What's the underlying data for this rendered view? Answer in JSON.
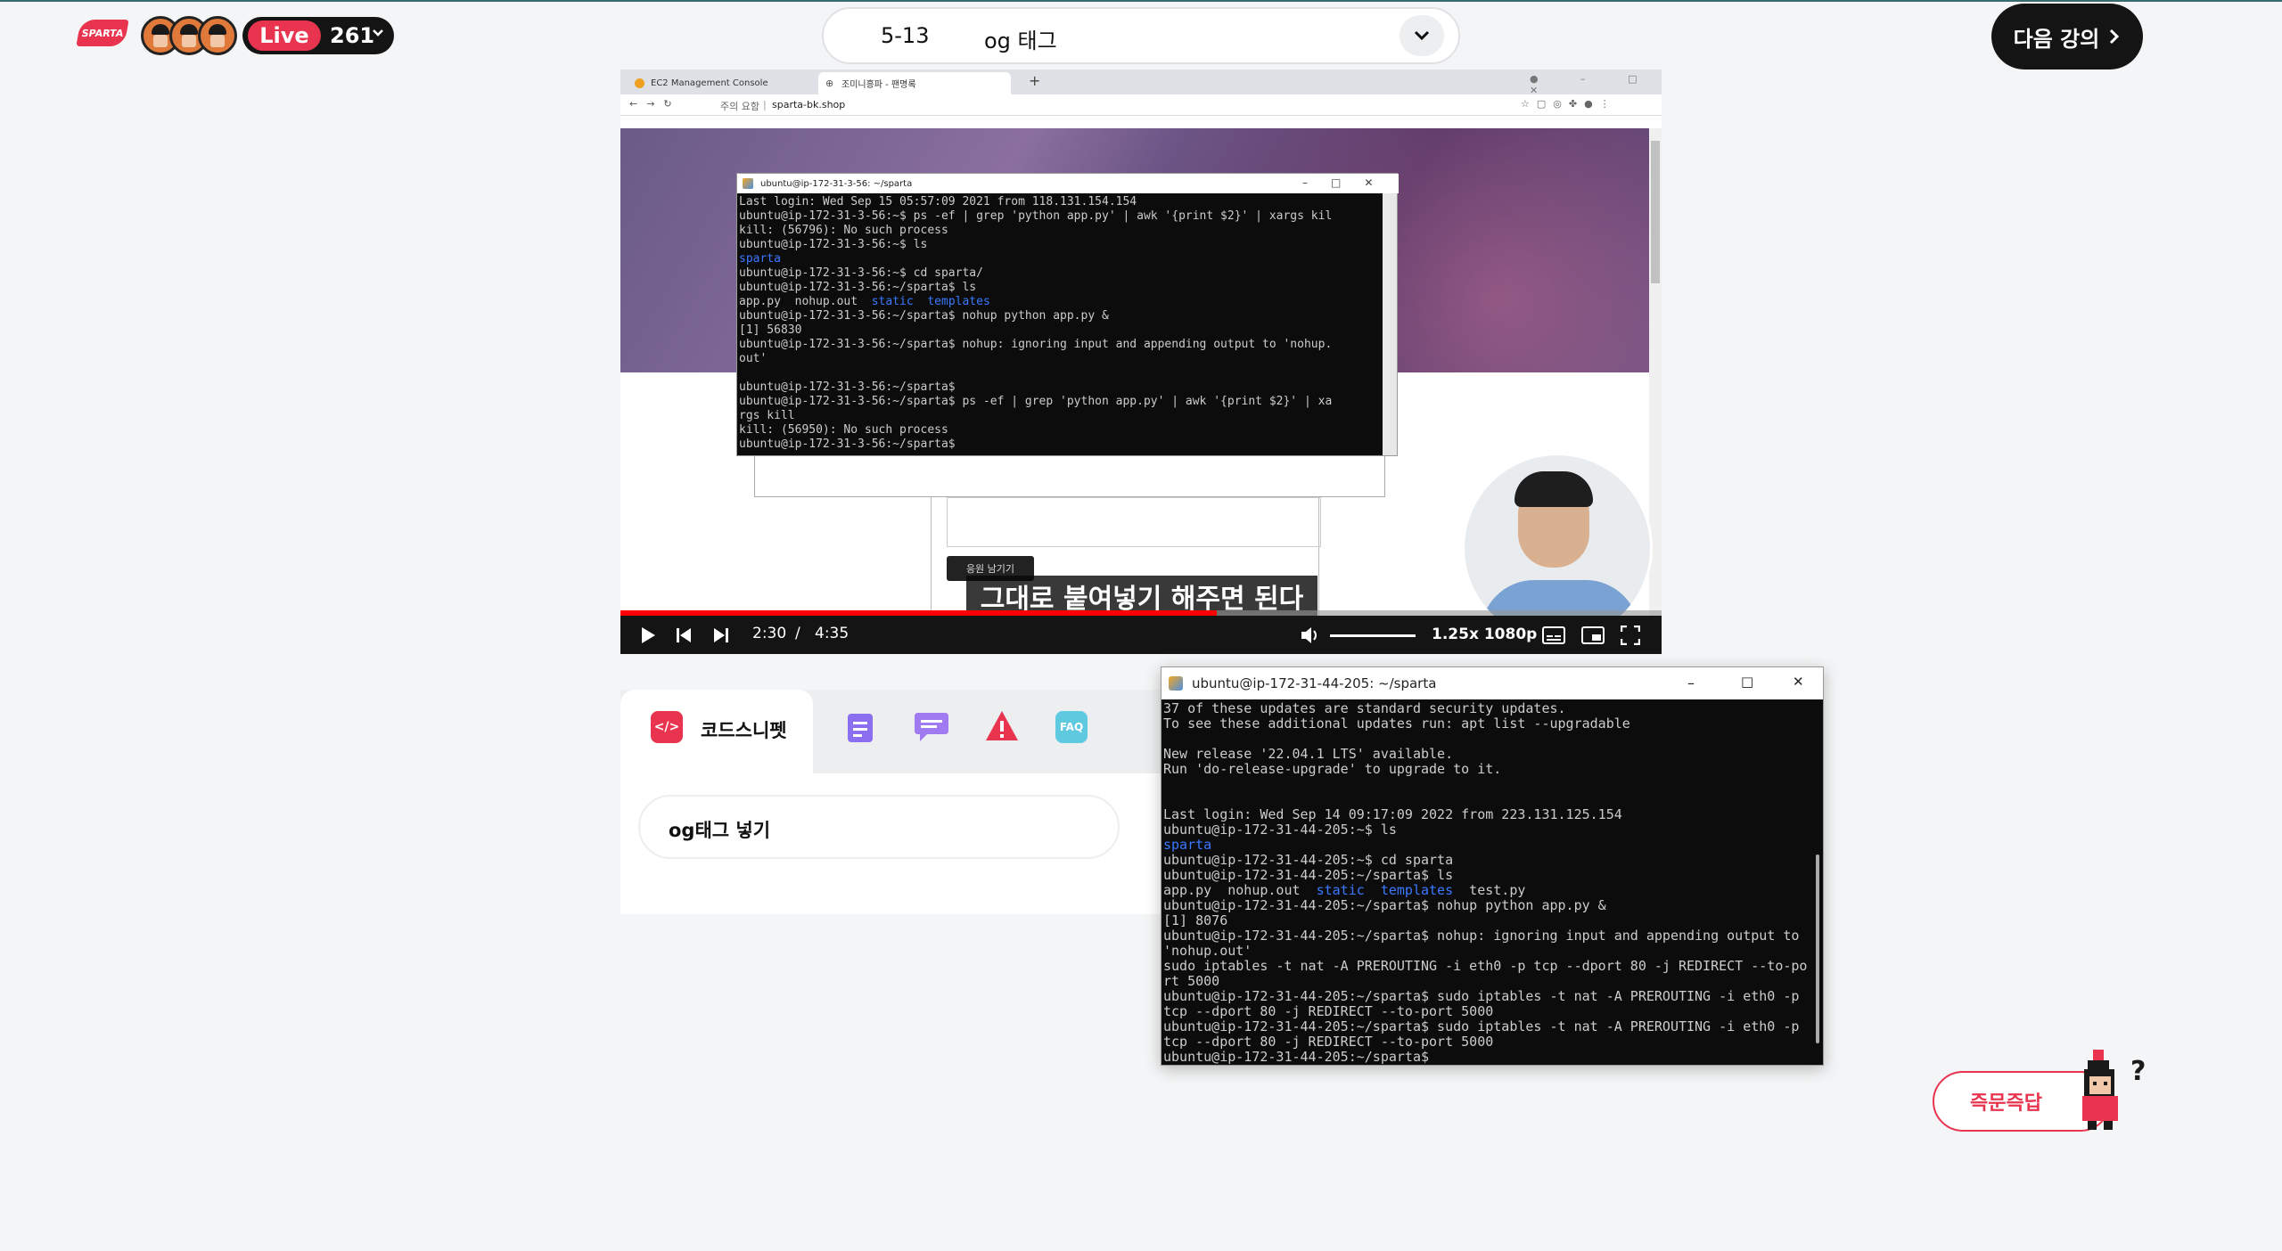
{
  "header": {
    "logo_text": "SPARTA",
    "live_label": "Live",
    "live_count": "261",
    "lecture_number": "5-13",
    "lecture_title": "og 태그",
    "next_button": "다음 강의"
  },
  "video": {
    "browser_tabs": [
      "EC2 Management Console",
      "조미니흥파 - 팬명록"
    ],
    "address_warning": "주의 요함",
    "address_url": "sparta-bk.shop",
    "form_button": "응원 남기기",
    "small_terminal": {
      "title": "ubuntu@ip-172-31-3-56: ~/sparta",
      "lines": [
        "Last login: Wed Sep 15 05:57:09 2021 from 118.131.154.154",
        "ubuntu@ip-172-31-3-56:~$ ps -ef | grep 'python app.py' | awk '{print $2}' | xargs kil",
        "kill: (56796): No such process",
        "ubuntu@ip-172-31-3-56:~$ ls",
        "sparta",
        "ubuntu@ip-172-31-3-56:~$ cd sparta/",
        "ubuntu@ip-172-31-3-56:~/sparta$ ls",
        "app.py  nohup.out  static  templates",
        "ubuntu@ip-172-31-3-56:~/sparta$ nohup python app.py &",
        "[1] 56830",
        "ubuntu@ip-172-31-3-56:~/sparta$ nohup: ignoring input and appending output to 'nohup.",
        "out'",
        "",
        "ubuntu@ip-172-31-3-56:~/sparta$",
        "ubuntu@ip-172-31-3-56:~/sparta$ ps -ef | grep 'python app.py' | awk '{print $2}' | xa",
        "rgs kill",
        "kill: (56950): No such process",
        "ubuntu@ip-172-31-3-56:~/sparta$"
      ]
    },
    "caption": "그대로 붙여넣기 해주면 된다",
    "progress": 0.5725,
    "time_current": "2:30",
    "time_separator": "/",
    "time_total": "4:35",
    "speed_quality": "1.25x 1080p"
  },
  "lower_panel": {
    "tab_code_label": "코드스니펫",
    "tab_faq_label": "FAQ",
    "snippet_text": "og태그 넣기"
  },
  "big_terminal": {
    "title": "ubuntu@ip-172-31-44-205: ~/sparta",
    "lines": [
      "37 of these updates are standard security updates.",
      "To see these additional updates run: apt list --upgradable",
      "",
      "New release '22.04.1 LTS' available.",
      "Run 'do-release-upgrade' to upgrade to it.",
      "",
      "",
      "Last login: Wed Sep 14 09:17:09 2022 from 223.131.125.154",
      "ubuntu@ip-172-31-44-205:~$ ls",
      "sparta",
      "ubuntu@ip-172-31-44-205:~$ cd sparta",
      "ubuntu@ip-172-31-44-205:~/sparta$ ls",
      "app.py  nohup.out  static  templates  test.py",
      "ubuntu@ip-172-31-44-205:~/sparta$ nohup python app.py &",
      "[1] 8076",
      "ubuntu@ip-172-31-44-205:~/sparta$ nohup: ignoring input and appending output to",
      "'nohup.out'",
      "sudo iptables -t nat -A PREROUTING -i eth0 -p tcp --dport 80 -j REDIRECT --to-po",
      "rt 5000",
      "ubuntu@ip-172-31-44-205:~/sparta$ sudo iptables -t nat -A PREROUTING -i eth0 -p",
      "tcp --dport 80 -j REDIRECT --to-port 5000",
      "ubuntu@ip-172-31-44-205:~/sparta$ sudo iptables -t nat -A PREROUTING -i eth0 -p",
      "tcp --dport 80 -j REDIRECT --to-port 5000",
      "ubuntu@ip-172-31-44-205:~/sparta$"
    ]
  },
  "qa_button": "즉문즉답",
  "colors": {
    "brand_red": "#e8344e",
    "dark": "#141414",
    "terminal_blue": "#3b78ff"
  },
  "icons": [
    "chevron-down-icon",
    "chevron-right-icon",
    "play-icon",
    "prev-icon",
    "next-icon",
    "volume-icon",
    "subtitles-icon",
    "theater-icon",
    "fullscreen-icon",
    "code-icon",
    "notes-icon",
    "chat-icon",
    "warning-icon",
    "faq-icon"
  ]
}
